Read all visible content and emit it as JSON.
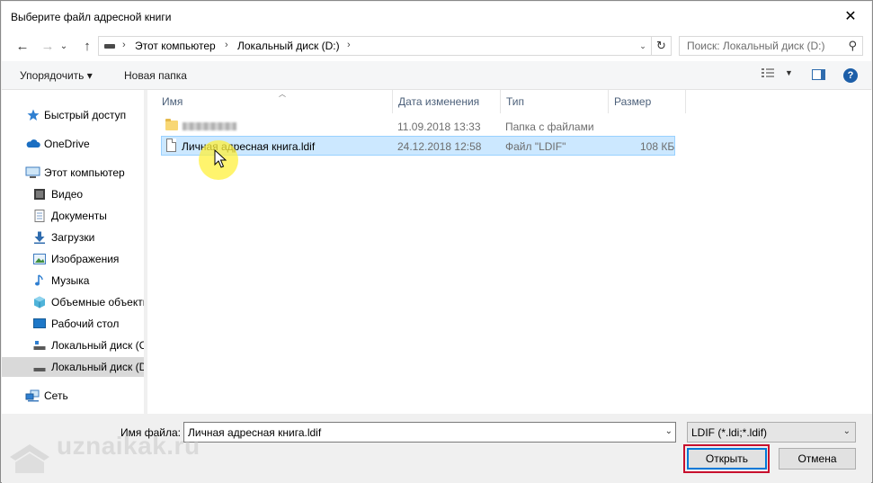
{
  "window": {
    "title": "Выберите файл адресной книги",
    "close_glyph": "✕"
  },
  "nav": {
    "back_glyph": "←",
    "forward_glyph": "→",
    "recent_glyph": "⌄",
    "up_glyph": "↑",
    "breadcrumbs": [
      "Этот компьютер",
      "Локальный диск (D:)"
    ],
    "crumb_sep": "›",
    "dropdown_glyph": "⌄",
    "refresh_glyph": "↻",
    "search_placeholder": "Поиск: Локальный диск (D:)",
    "search_glyph": "⚲"
  },
  "toolbar": {
    "organize_label": "Упорядочить ▾",
    "new_folder_label": "Новая папка",
    "view_dropdown_glyph": "▼",
    "help_glyph": "?"
  },
  "sidebar": {
    "items": [
      {
        "label": "Быстрый доступ",
        "icon": "star-icon"
      },
      {
        "label": "OneDrive",
        "icon": "cloud-icon"
      },
      {
        "label": "Этот компьютер",
        "icon": "computer-icon"
      },
      {
        "label": "Видео",
        "icon": "video-icon"
      },
      {
        "label": "Документы",
        "icon": "documents-icon"
      },
      {
        "label": "Загрузки",
        "icon": "downloads-icon"
      },
      {
        "label": "Изображения",
        "icon": "pictures-icon"
      },
      {
        "label": "Музыка",
        "icon": "music-icon"
      },
      {
        "label": "Объемные объекты",
        "icon": "3d-objects-icon"
      },
      {
        "label": "Рабочий стол",
        "icon": "desktop-icon"
      },
      {
        "label": "Локальный диск (C:)",
        "icon": "drive-icon"
      },
      {
        "label": "Локальный диск (D:)",
        "icon": "drive-icon",
        "selected": true
      },
      {
        "label": "Сеть",
        "icon": "network-icon"
      }
    ]
  },
  "columns": {
    "name": "Имя",
    "date": "Дата изменения",
    "type": "Тип",
    "size": "Размер"
  },
  "files": [
    {
      "name": "",
      "date": "11.09.2018 13:33",
      "type": "Папка с файлами",
      "size": "",
      "kind": "folder"
    },
    {
      "name": "Личная адресная книга.ldif",
      "date": "24.12.2018 12:58",
      "type": "Файл \"LDIF\"",
      "size": "108 КБ",
      "kind": "file",
      "selected": true
    }
  ],
  "bottom": {
    "filename_label": "Имя файла:",
    "filename_value": "Личная адресная книга.ldif",
    "filter_value": "LDIF (*.ldi;*.ldif)",
    "dropdown_glyph": "⌄",
    "open_label": "Открыть",
    "cancel_label": "Отмена"
  },
  "watermark": "uznaikak.ru",
  "colors": {
    "selection": "#cce8ff",
    "accent": "#0078d7",
    "highlight_frame": "#c8102e",
    "cursor_highlight": "#fff03c"
  }
}
